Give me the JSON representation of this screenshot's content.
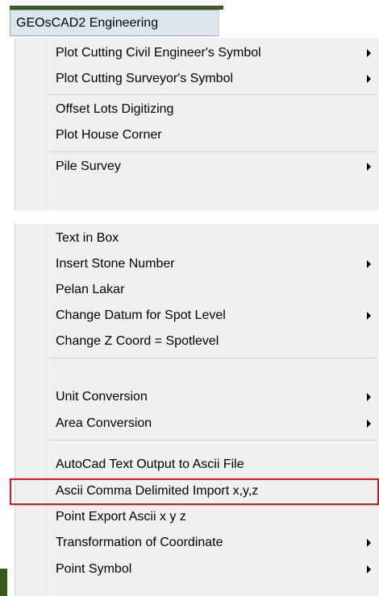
{
  "menu": {
    "title": "GEOsCAD2 Engineering"
  },
  "panel1": {
    "items": [
      {
        "label": "Plot Cutting Civil Engineer's Symbol",
        "submenu": true
      },
      {
        "label": "Plot Cutting Surveyor's Symbol",
        "submenu": true
      },
      {
        "label": "Offset Lots Digitizing",
        "submenu": false
      },
      {
        "label": "Plot House Corner",
        "submenu": false
      },
      {
        "label": "Pile Survey",
        "submenu": true
      }
    ]
  },
  "panel2": {
    "items": [
      {
        "label": "Text in Box",
        "submenu": false
      },
      {
        "label": "Insert Stone Number",
        "submenu": true
      },
      {
        "label": "Pelan Lakar",
        "submenu": false
      },
      {
        "label": "Change Datum for Spot Level",
        "submenu": true
      },
      {
        "label": "Change Z Coord = Spotlevel",
        "submenu": false
      },
      {
        "label": "Unit Conversion",
        "submenu": true
      },
      {
        "label": "Area Conversion",
        "submenu": true
      },
      {
        "label": "AutoCad Text Output to Ascii File",
        "submenu": false
      },
      {
        "label": "Ascii Comma Delimited Import x,y,z",
        "submenu": false,
        "highlighted": true
      },
      {
        "label": "Point Export Ascii x y z",
        "submenu": false
      },
      {
        "label": "Transformation of Coordinate",
        "submenu": true
      },
      {
        "label": "Point Symbol",
        "submenu": true
      }
    ]
  },
  "colors": {
    "highlight_border": "#e0121b",
    "menu_bg": "#f0f0f0",
    "title_bg": "#dde6ef",
    "accent_bar": "#3b5a1f"
  }
}
